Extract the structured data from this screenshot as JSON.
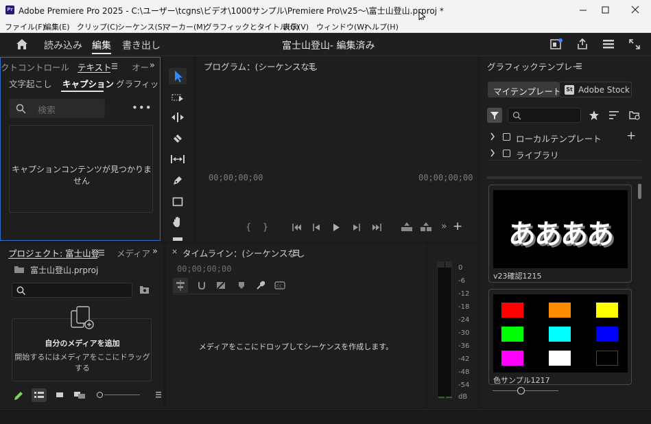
{
  "window": {
    "title": "Adobe Premiere Pro 2025 - C:\\ユーザー\\tcgns\\ビデオ\\1000サンプル\\Premiere Pro\\v25～\\富士山登山.prproj *",
    "app_icon": "Pr"
  },
  "menu": [
    "ファイル(F)",
    "編集(E)",
    "クリップ(C)",
    "シーケンス(S)",
    "マーカー(M)",
    "グラフィックとタイトル(G)",
    "表示(V)",
    "ウィンドウ(W)",
    "ヘルプ(H)"
  ],
  "workspace": {
    "tabs": [
      "読み込み",
      "編集",
      "書き出し"
    ],
    "active_tab": "編集",
    "project_title": "富士山登山- 編集済み"
  },
  "text_panel": {
    "tabs": [
      "クトコントロール",
      "テキスト",
      "オー"
    ],
    "subtabs": [
      "文字起こし",
      "キャプション",
      "グラフィック"
    ],
    "search_placeholder": "検索",
    "empty_message": "キャプションコンテンツが見つかりません"
  },
  "program_monitor": {
    "title": "プログラム：(シーケンスなし",
    "timecode_left": "00;00;00;00",
    "timecode_right": "00;00;00;00"
  },
  "essential_graphics": {
    "title": "グラフィックテンプレー",
    "tabs": [
      "マイテンプレート",
      "Adobe Stock"
    ],
    "stock_badge": "St",
    "tree": [
      "ローカルテンプレート",
      "ライブラリ"
    ],
    "templates": [
      {
        "label": "v23確認1215",
        "preview_text": "ああああ"
      },
      {
        "label": "色サンプル1217",
        "swatches": [
          "#ff0000",
          "#ff8c00",
          "#ffff00",
          "#00ff00",
          "#00ffff",
          "#0000ff",
          "#ff00ff",
          "#ffffff",
          "#000000"
        ]
      }
    ]
  },
  "project_panel": {
    "tabs": [
      "プロジェクト: 富士山登",
      "メディア"
    ],
    "file": "富士山登山.prproj",
    "drop_title": "自分のメディアを追加",
    "drop_sub": "開始するにはメディアをここにドラッグする"
  },
  "timeline": {
    "title": "タイムライン：(シーケンスなし",
    "timecode": "00;00;00;00",
    "empty_message": "メディアをここにドロップしてシーケンスを作成します。"
  },
  "audio_meter": {
    "scale": [
      "0",
      "-6",
      "-12",
      "-18",
      "-24",
      "-30",
      "-36",
      "-42",
      "-48",
      "-54",
      "dB"
    ]
  }
}
